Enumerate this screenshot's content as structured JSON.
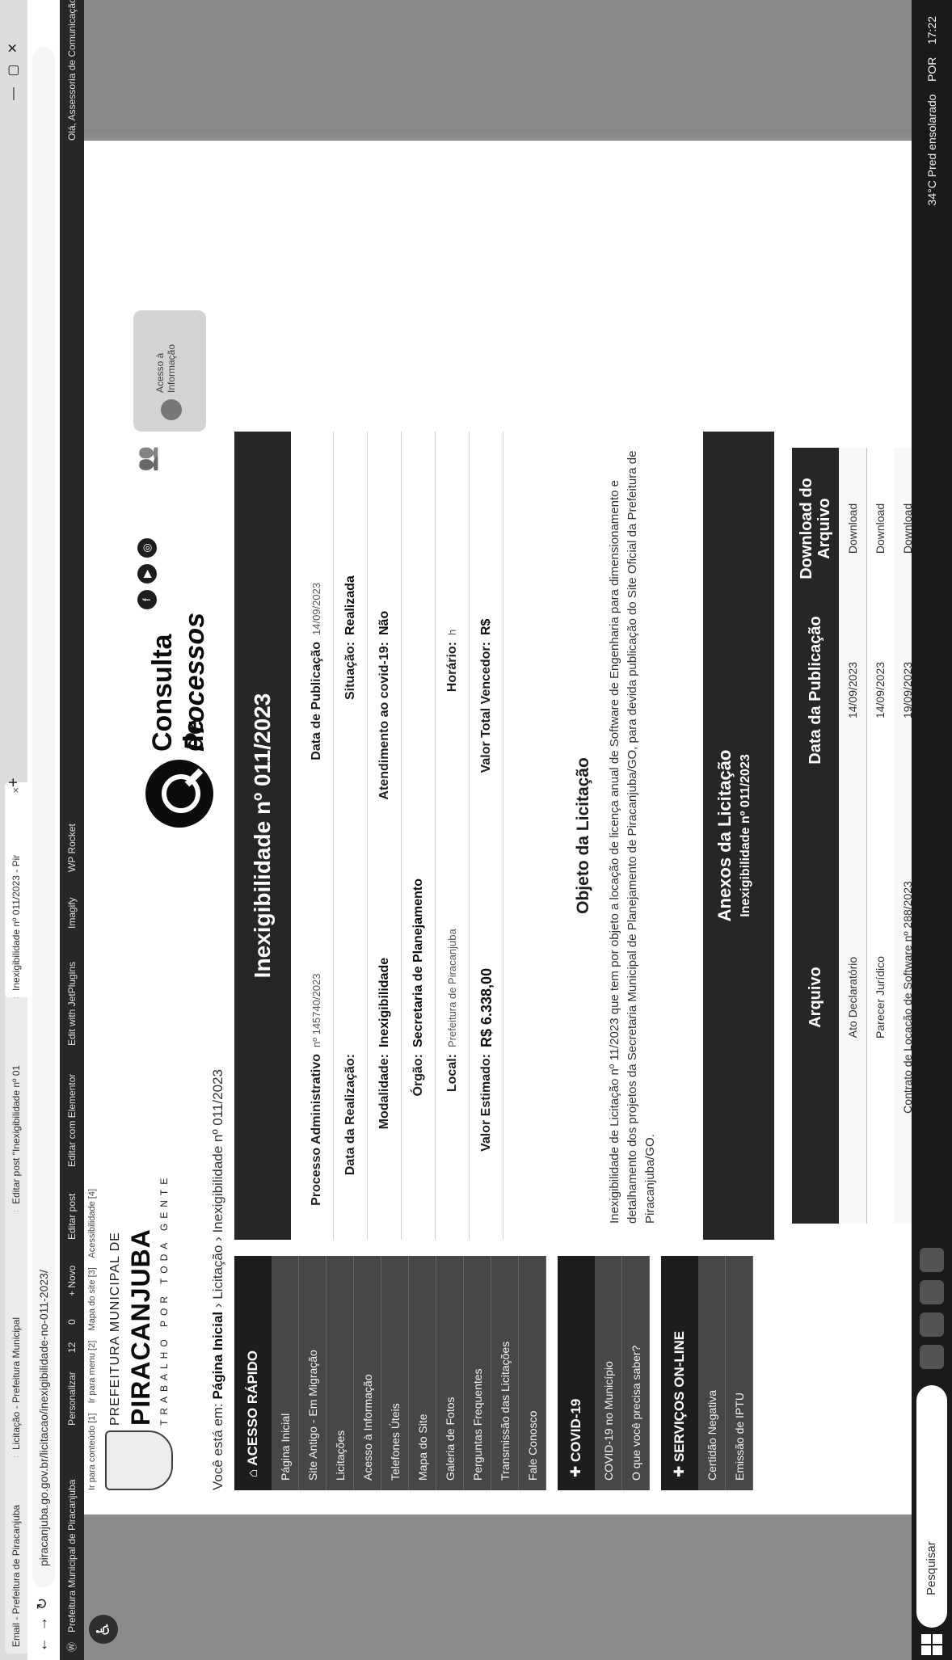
{
  "tabs": [
    {
      "label": "Email - Prefeitura de Piracanjuba"
    },
    {
      "label": "Licitação - Prefeitura Municipal"
    },
    {
      "label": "Editar post \"Inexigibilidade nº 01"
    },
    {
      "label": "Inexigibilidade nº 011/2023 - Pir"
    }
  ],
  "address": {
    "url": "piracanjuba.go.gov.br/licitacao/inexigibilidade-no-011-2023/"
  },
  "wpbar": {
    "site": "Prefeitura Municipal de Piracanjuba",
    "customize": "Personalizar",
    "updates": "12",
    "comments": "0",
    "new": "+ Novo",
    "edit_post": "Editar post",
    "elementor": "Editar com Elementor",
    "jetplugins": "Edit with JetPlugins",
    "imagify": "Imagify",
    "wprocket": "WP Rocket",
    "skip1": "Ir para conteúdo [1]",
    "skip2": "Ir para menu [2]",
    "skip3": "Mapa do site [3]",
    "skip4": "Acessibilidade [4]",
    "greeting": "Olá, Assessoria de Comunicação"
  },
  "logo": {
    "line1": "PREFEITURA MUNICIPAL DE",
    "line2": "PIRACANJUBA",
    "line3": "TRABALHO POR TODA GENTE"
  },
  "consulta": {
    "line1": "Consulta de",
    "line2": "Processos"
  },
  "acesso_info": {
    "label": "Acesso à Informação"
  },
  "breadcrumb": {
    "prefix": "Você está em:",
    "home": "Página Inicial",
    "section": "Licitação",
    "current": "Inexigibilidade nº 011/2023"
  },
  "sidebar": {
    "acesso_title": "ACESSO RÁPIDO",
    "acesso_items": [
      "Página Inicial",
      "Site Antigo - Em Migração",
      "Licitações",
      "Acesso à Informação",
      "Telefones Úteis",
      "Mapa do Site",
      "Galeria de Fotos",
      "Perguntas Frequentes",
      "Transmissão das Licitações",
      "Fale Conosco"
    ],
    "covid_title": "COVID-19",
    "covid_items": [
      "COVID-19 no Município",
      "O que você precisa saber?"
    ],
    "servicos_title": "SERVIÇOS ON-LINE",
    "servicos_items": [
      "Certidão Negativa",
      "Emissão de IPTU"
    ]
  },
  "main": {
    "title": "Inexigibilidade nº 011/2023",
    "fields": {
      "processo_label": "Processo Administrativo",
      "processo_value": "nº 145740/2023",
      "publicacao_label": "Data de Publicação",
      "publicacao_value": "14/09/2023",
      "realizacao_label": "Data da Realização:",
      "realizacao_value": "",
      "situacao_label": "Situação:",
      "situacao_value": "Realizada",
      "modalidade_label": "Modalidade:",
      "modalidade_value": "Inexigibilidade",
      "covid_label": "Atendimento ao covid-19:",
      "covid_value": "Não",
      "orgao_label": "Órgão:",
      "orgao_value": "Secretaria de Planejamento",
      "local_label": "Local:",
      "local_value": "Prefeitura de Piracanjuba",
      "horario_label": "Horário:",
      "horario_value": "h",
      "valor_label": "Valor Estimado:",
      "valor_value": "R$ 6.338,00",
      "vencedor_label": "Valor Total Vencedor:",
      "vencedor_value": "R$"
    },
    "objeto_title": "Objeto da Licitação",
    "objeto_text": "Inexigibilidade de Licitação nº 11/2023 que tem por objeto a locação de licença anual de Software de Engenharia para dimensionamento e detalhamento dos projetos da Secretaria Municipal de Planejamento de Piracanjuba/GO, para devida publicação do Site Oficial da Prefeitura de Piracanjuba/GO.",
    "anexos_title": "Anexos da Licitação",
    "anexos_sub": "Inexigibilidade nº 011/2023",
    "files_headers": {
      "arquivo": "Arquivo",
      "data": "Data da Publicação",
      "download": "Download do Arquivo"
    },
    "files": [
      {
        "name": "Ato Declaratório",
        "date": "14/09/2023",
        "action": "Download"
      },
      {
        "name": "Parecer Jurídico",
        "date": "14/09/2023",
        "action": "Download"
      },
      {
        "name": "Contrato de Locação de Software nº 288/2023",
        "date": "19/09/2023",
        "action": "Download"
      }
    ]
  },
  "taskbar": {
    "search": "Pesquisar",
    "weather": "34°C  Pred ensolarado",
    "lang": "POR",
    "time": "17:22"
  }
}
